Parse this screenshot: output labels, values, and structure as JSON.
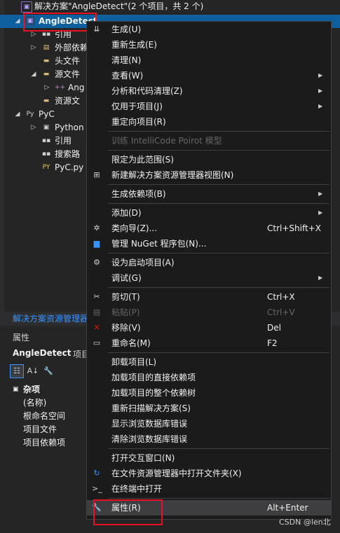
{
  "tree": {
    "solution_label": "解决方案\"AngleDetect\"(2 个项目，共 2 个)",
    "items": [
      {
        "label": "AngleDetect",
        "icon": "csharp-project-icon",
        "expander": "▲",
        "selected": true
      },
      {
        "label": "引用",
        "icon": "references-icon",
        "expander": "▶"
      },
      {
        "label": "外部依赖",
        "icon": "external-deps-icon",
        "expander": "▶"
      },
      {
        "label": "头文件",
        "icon": "folder-icon",
        "expander": ""
      },
      {
        "label": "源文件",
        "icon": "folder-icon",
        "expander": "▲"
      },
      {
        "label": "Ang",
        "icon": "cpp-file-icon",
        "expander": "▶"
      },
      {
        "label": "资源文",
        "icon": "folder-icon",
        "expander": ""
      },
      {
        "label": "PyC",
        "icon": "python-project-icon",
        "expander": "▲"
      },
      {
        "label": "Python",
        "icon": "python-env-icon",
        "expander": "▶"
      },
      {
        "label": "引用",
        "icon": "references-icon",
        "expander": ""
      },
      {
        "label": "搜索路",
        "icon": "search-paths-icon",
        "expander": ""
      },
      {
        "label": "PyC.py",
        "icon": "python-file-icon",
        "expander": ""
      }
    ],
    "footer_title": "解决方案资源管理器"
  },
  "properties": {
    "header": "属性",
    "object_name": "AngleDetect",
    "object_kind": "项目",
    "category": "杂项",
    "rows": [
      "(名称)",
      "根命名空间",
      "项目文件",
      "项目依赖项"
    ]
  },
  "menu": {
    "items": [
      {
        "label": "生成(U)",
        "icon": "build-icon"
      },
      {
        "label": "重新生成(E)"
      },
      {
        "label": "清理(N)"
      },
      {
        "label": "查看(W)",
        "submenu": true
      },
      {
        "label": "分析和代码清理(Z)",
        "submenu": true
      },
      {
        "label": "仅用于项目(J)",
        "submenu": true
      },
      {
        "label": "重定向项目(R)"
      },
      {
        "sep": true
      },
      {
        "label": "训练 IntelliCode Poirot 模型",
        "disabled": true
      },
      {
        "sep": true
      },
      {
        "label": "限定为此范围(S)"
      },
      {
        "label": "新建解决方案资源管理器视图(N)",
        "icon": "new-view-icon"
      },
      {
        "sep": true
      },
      {
        "label": "生成依赖项(B)",
        "submenu": true
      },
      {
        "sep": true
      },
      {
        "label": "添加(D)",
        "submenu": true
      },
      {
        "label": "类向导(Z)...",
        "icon": "class-wizard-icon",
        "shortcut": "Ctrl+Shift+X"
      },
      {
        "label": "管理 NuGet 程序包(N)...",
        "icon": "nuget-icon"
      },
      {
        "sep": true
      },
      {
        "label": "设为启动项目(A)",
        "icon": "gear-icon"
      },
      {
        "label": "调试(G)",
        "submenu": true
      },
      {
        "sep": true
      },
      {
        "label": "剪切(T)",
        "icon": "scissors-icon",
        "shortcut": "Ctrl+X"
      },
      {
        "label": "粘贴(P)",
        "icon": "paste-icon",
        "shortcut": "Ctrl+V",
        "disabled": true
      },
      {
        "label": "移除(V)",
        "icon": "remove-icon",
        "shortcut": "Del"
      },
      {
        "label": "重命名(M)",
        "icon": "rename-icon",
        "shortcut": "F2"
      },
      {
        "sep": true
      },
      {
        "label": "卸载项目(L)"
      },
      {
        "label": "加载项目的直接依赖项"
      },
      {
        "label": "加载项目的整个依赖树"
      },
      {
        "label": "重新扫描解决方案(S)"
      },
      {
        "label": "显示浏览数据库错误"
      },
      {
        "label": "清除浏览数据库错误"
      },
      {
        "sep": true
      },
      {
        "label": "打开交互窗口(N)"
      },
      {
        "label": "在文件资源管理器中打开文件夹(X)",
        "icon": "open-folder-icon"
      },
      {
        "label": "在终端中打开",
        "icon": "terminal-icon"
      },
      {
        "sep": true
      },
      {
        "label": "属性(R)",
        "icon": "wrench-icon",
        "shortcut": "Alt+Enter",
        "highlighted": true
      }
    ]
  },
  "watermark": "CSDN @len北",
  "colors": {
    "accent": "#3794ff",
    "selection": "#0e5f9e",
    "annotation": "#e81123",
    "menu_bg": "#1b1b1c"
  }
}
